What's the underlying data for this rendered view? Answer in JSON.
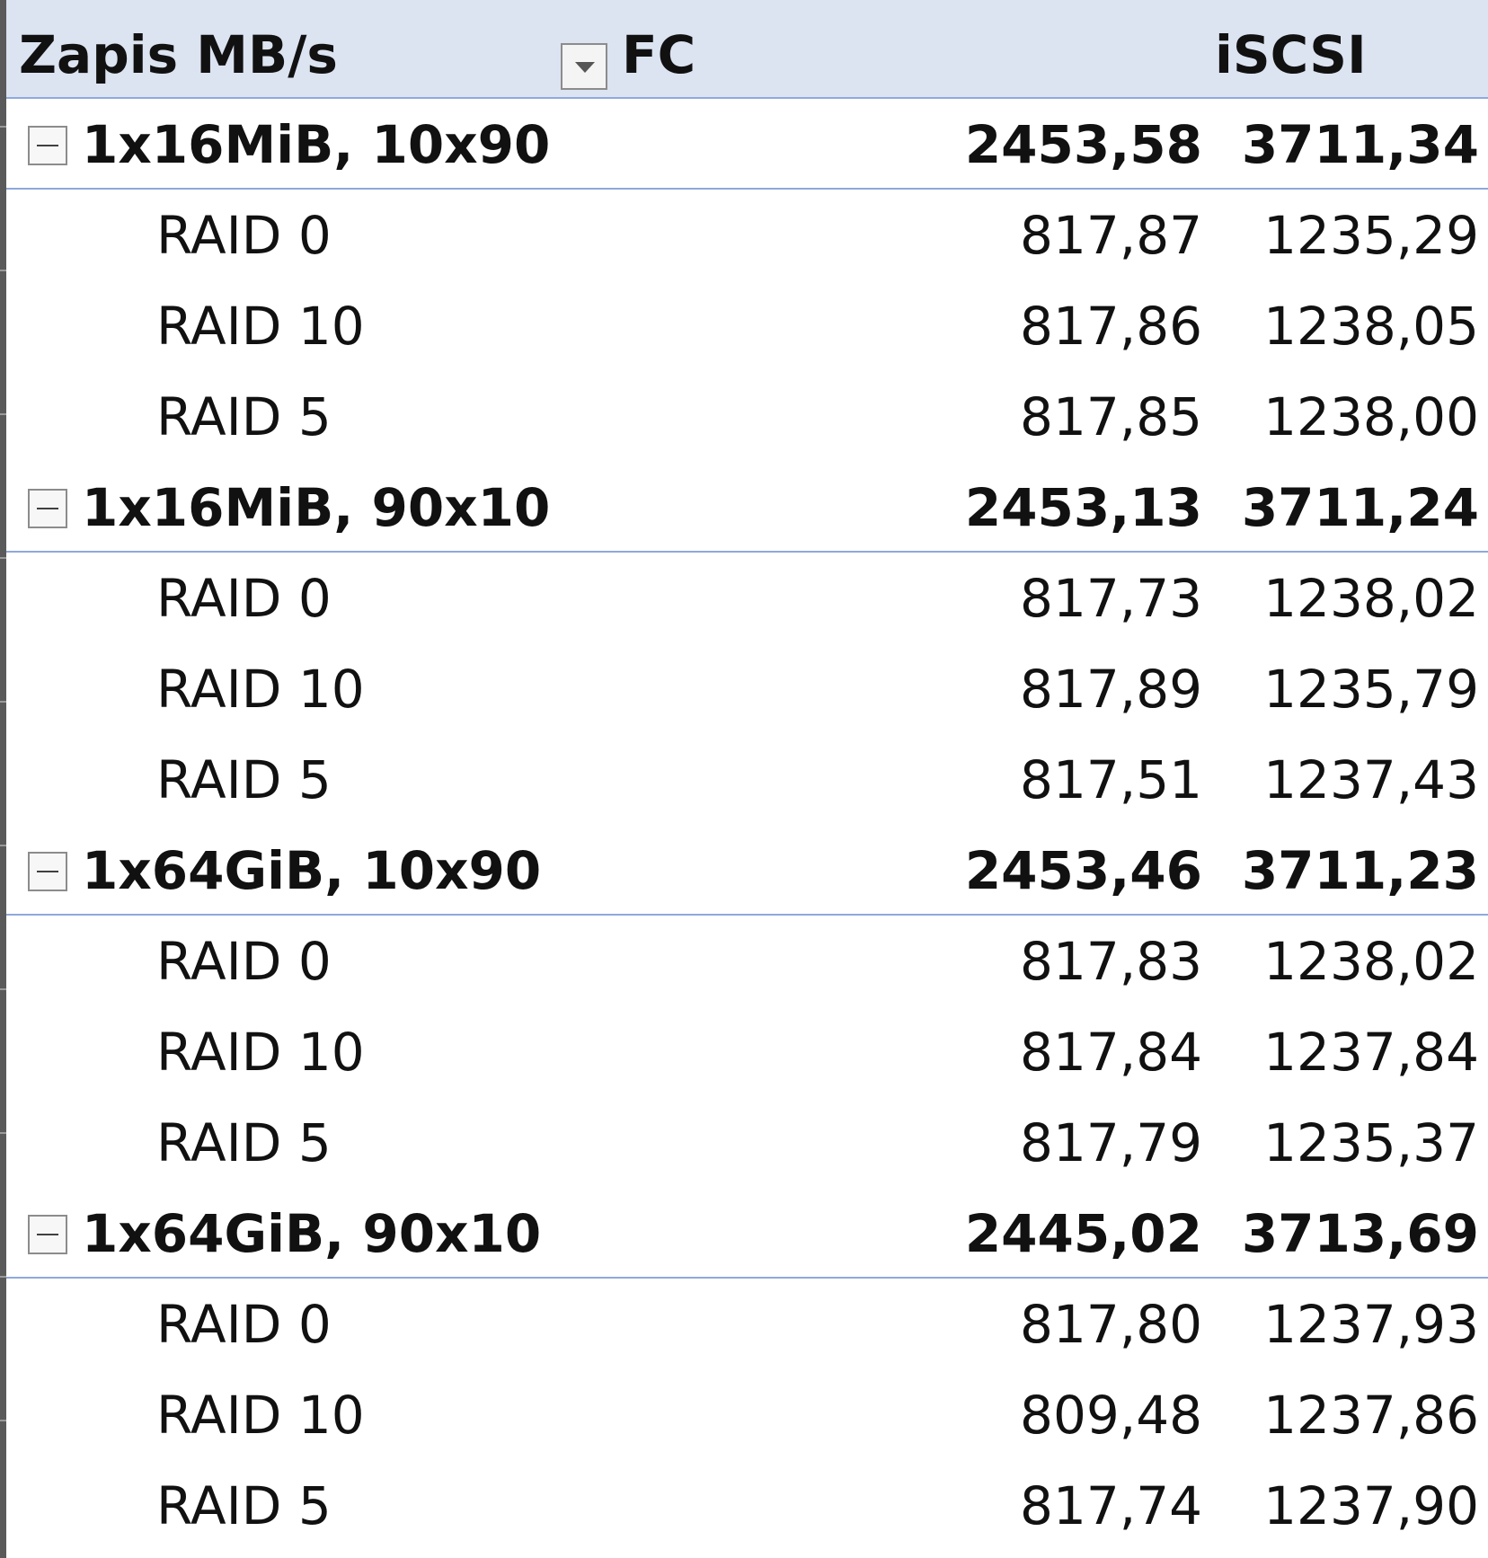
{
  "pivot": {
    "header": {
      "title": "Zapis MB/s",
      "col_fc": "FC",
      "col_iscsi": "iSCSI"
    },
    "groups": [
      {
        "label": "1x16MiB, 10x90",
        "fc": "2453,58",
        "iscsi": "3711,34",
        "items": [
          {
            "label": "RAID 0",
            "fc": "817,87",
            "iscsi": "1235,29"
          },
          {
            "label": "RAID 10",
            "fc": "817,86",
            "iscsi": "1238,05"
          },
          {
            "label": "RAID 5",
            "fc": "817,85",
            "iscsi": "1238,00"
          }
        ]
      },
      {
        "label": "1x16MiB, 90x10",
        "fc": "2453,13",
        "iscsi": "3711,24",
        "items": [
          {
            "label": "RAID 0",
            "fc": "817,73",
            "iscsi": "1238,02"
          },
          {
            "label": "RAID 10",
            "fc": "817,89",
            "iscsi": "1235,79"
          },
          {
            "label": "RAID 5",
            "fc": "817,51",
            "iscsi": "1237,43"
          }
        ]
      },
      {
        "label": "1x64GiB, 10x90",
        "fc": "2453,46",
        "iscsi": "3711,23",
        "items": [
          {
            "label": "RAID 0",
            "fc": "817,83",
            "iscsi": "1238,02"
          },
          {
            "label": "RAID 10",
            "fc": "817,84",
            "iscsi": "1237,84"
          },
          {
            "label": "RAID 5",
            "fc": "817,79",
            "iscsi": "1235,37"
          }
        ]
      },
      {
        "label": "1x64GiB, 90x10",
        "fc": "2445,02",
        "iscsi": "3713,69",
        "items": [
          {
            "label": "RAID 0",
            "fc": "817,80",
            "iscsi": "1237,93"
          },
          {
            "label": "RAID 10",
            "fc": "809,48",
            "iscsi": "1237,86"
          },
          {
            "label": "RAID 5",
            "fc": "817,74",
            "iscsi": "1237,90"
          }
        ]
      }
    ]
  },
  "colors": {
    "header_bg": "#dce3f1",
    "group_border": "#8ea9db"
  },
  "icons": {
    "filter": "dropdown-arrow-icon",
    "collapse": "minus-box-icon"
  }
}
